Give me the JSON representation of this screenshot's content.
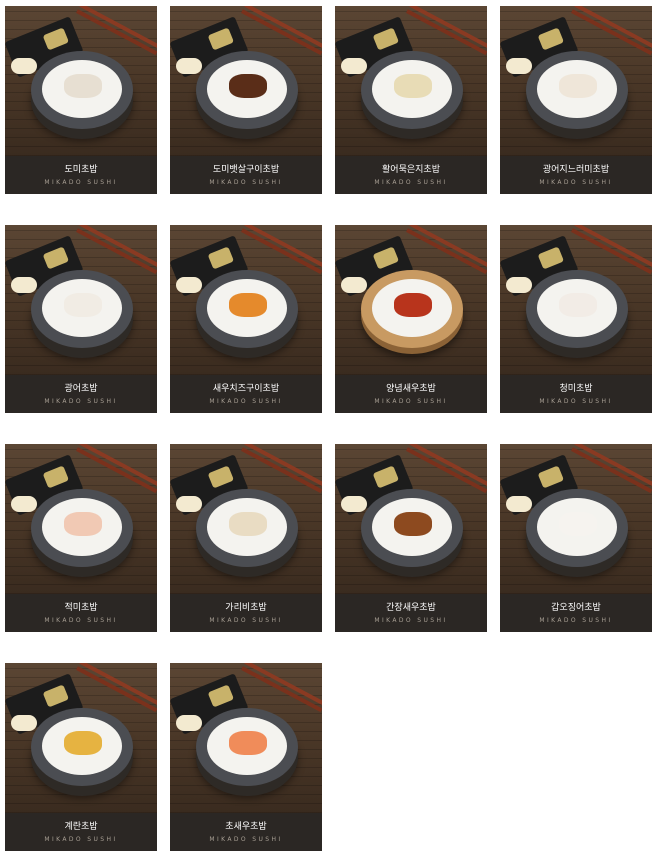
{
  "menu": {
    "items": [
      {
        "name": "도미초밥",
        "brand": "MIKADO SUSHI",
        "food": "sea-bream-sushi",
        "color": "#e7dfd2"
      },
      {
        "name": "도미뱃살구이초밥",
        "brand": "MIKADO SUSHI",
        "food": "grilled-sea-bream-belly-sushi",
        "color": "#5a2d18"
      },
      {
        "name": "활어묵은지초밥",
        "brand": "MIKADO SUSHI",
        "food": "raw-fish-aged-kimchi-sushi",
        "color": "#e8dcb6"
      },
      {
        "name": "광어지느러미초밥",
        "brand": "MIKADO SUSHI",
        "food": "flatfish-fin-sushi",
        "color": "#efe6d9"
      },
      {
        "name": "광어초밥",
        "brand": "MIKADO SUSHI",
        "food": "flatfish-sushi",
        "color": "#f1ece4"
      },
      {
        "name": "새우치즈구이초밥",
        "brand": "MIKADO SUSHI",
        "food": "grilled-shrimp-cheese-sushi",
        "color": "#e58a2c"
      },
      {
        "name": "양념새우초밥",
        "brand": "MIKADO SUSHI",
        "food": "seasoned-shrimp-sushi",
        "color": "#b8341c",
        "plate": "wood"
      },
      {
        "name": "청미초밥",
        "brand": "MIKADO SUSHI",
        "food": "shrimp-sushi",
        "color": "#f2ece6"
      },
      {
        "name": "적미초밥",
        "brand": "MIKADO SUSHI",
        "food": "red-shrimp-sushi",
        "color": "#f1c9b4"
      },
      {
        "name": "가리비초밥",
        "brand": "MIKADO SUSHI",
        "food": "scallop-sushi",
        "color": "#e9dcc3"
      },
      {
        "name": "간장새우초밥",
        "brand": "MIKADO SUSHI",
        "food": "soy-shrimp-sushi",
        "color": "#8d4a1f"
      },
      {
        "name": "갑오징어초밥",
        "brand": "MIKADO SUSHI",
        "food": "cuttlefish-sushi",
        "color": "#f6f3ef"
      },
      {
        "name": "계란초밥",
        "brand": "MIKADO SUSHI",
        "food": "egg-sushi",
        "color": "#e6b341"
      },
      {
        "name": "초새우초밥",
        "brand": "MIKADO SUSHI",
        "food": "vinegar-shrimp-sushi",
        "color": "#f08c5a"
      }
    ]
  }
}
